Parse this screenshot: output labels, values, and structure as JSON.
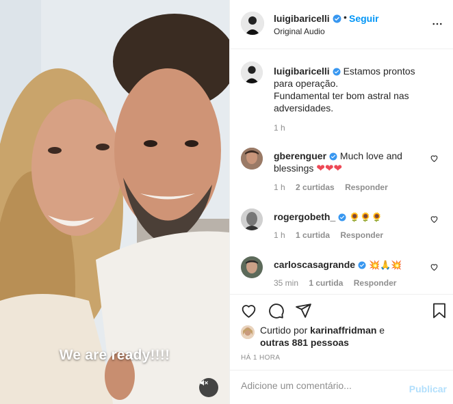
{
  "media": {
    "overlay_text": "We are ready!!!!",
    "mute_icon": "speaker-muted-icon"
  },
  "header": {
    "username": "luigibaricelli",
    "separator": "•",
    "follow_label": "Seguir",
    "subtitle": "Original Audio",
    "more_icon": "more-options-icon"
  },
  "caption": {
    "username": "luigibaricelli",
    "text_line1": "Estamos prontos para operação.",
    "text_line2": "Fundamental ter bom astral nas adversidades.",
    "time": "1 h"
  },
  "comments": [
    {
      "username": "gberenguer",
      "verified": true,
      "text": "Much love and blessings",
      "emojis": "❤❤❤",
      "time": "1 h",
      "likes": "2 curtidas",
      "reply": "Responder"
    },
    {
      "username": "rogergobeth_",
      "verified": true,
      "text": "",
      "emojis": "🌻🌻🌻",
      "time": "1 h",
      "likes": "1 curtida",
      "reply": "Responder"
    },
    {
      "username": "carloscasagrande",
      "verified": true,
      "text": "",
      "emojis": "💥🙏💥",
      "time": "35 min",
      "likes": "1 curtida",
      "reply": "Responder"
    }
  ],
  "likes": {
    "prefix": "Curtido por",
    "user": "karinaffridman",
    "and": "e",
    "others": "outras 881 pessoas"
  },
  "post_time": "HÁ 1 HORA",
  "add_comment": {
    "placeholder": "Adicione um comentário...",
    "publish_label": "Publicar"
  },
  "colors": {
    "accent": "#0095f6",
    "verified": "#3897f0",
    "muted_text": "#8e8e8e",
    "publish_disabled": "#b2dffc",
    "heart_red": "#ed4956"
  }
}
